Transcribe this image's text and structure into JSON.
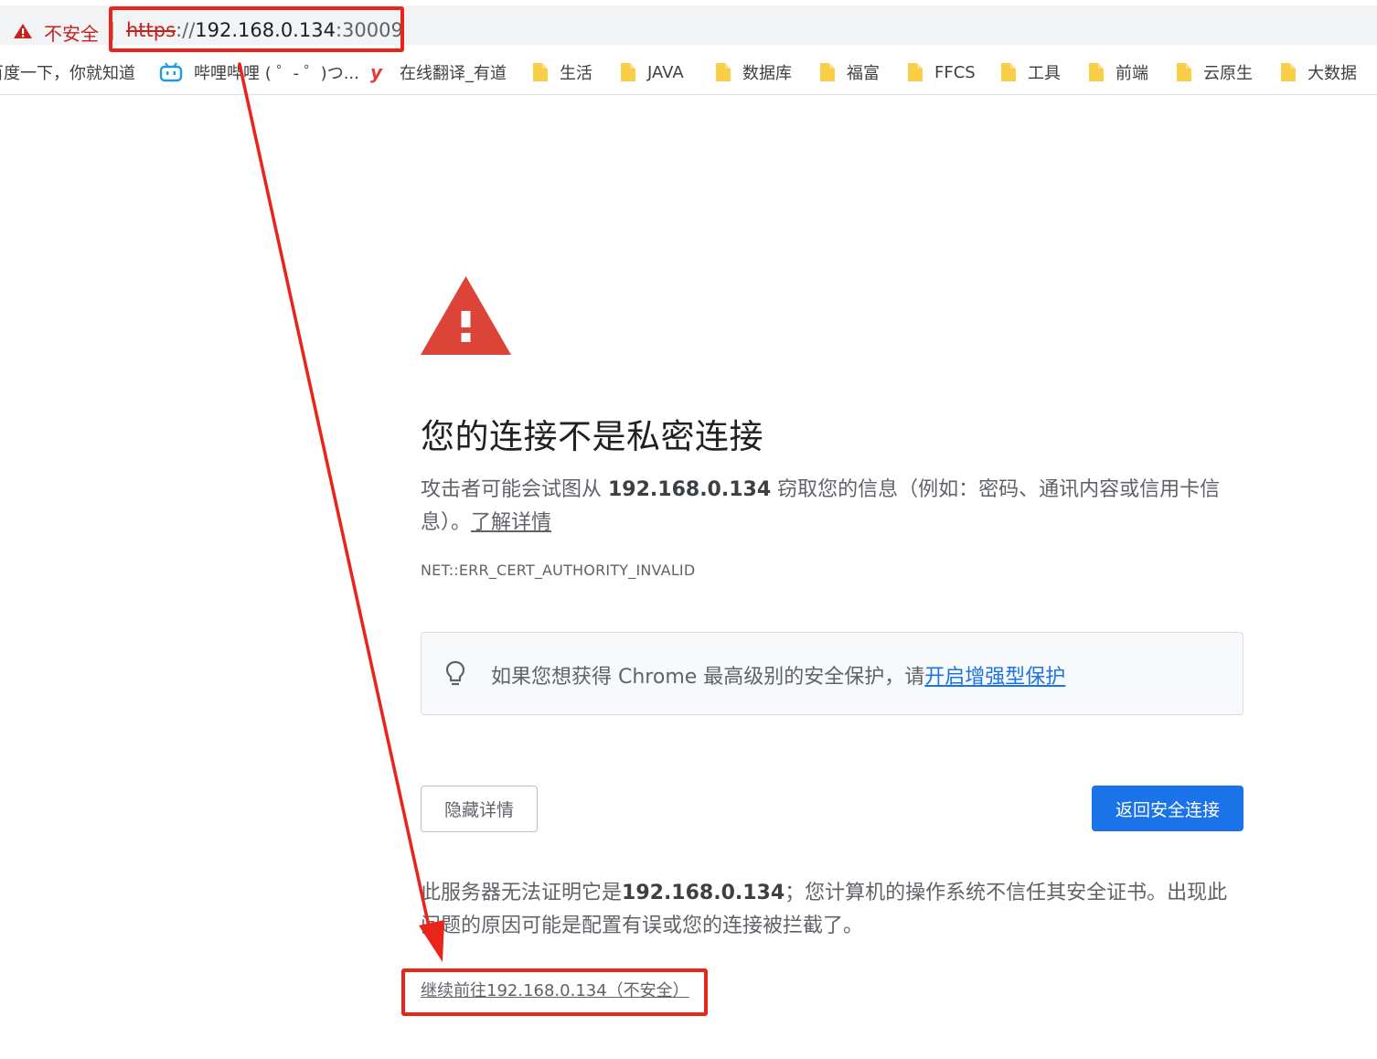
{
  "address_bar": {
    "security_label": "不安全",
    "url_scheme": "https",
    "url_separator": "://",
    "url_host": "192.168.0.134",
    "url_port": ":30009"
  },
  "bookmarks": [
    {
      "label": "百度一下，你就知道",
      "icon": "baidu-icon"
    },
    {
      "label": "哔哩哔哩 ( ゜- ゜)つ...",
      "icon": "bilibili-icon"
    },
    {
      "label": "在线翻译_有道",
      "icon": "youdao-icon"
    },
    {
      "label": "生活",
      "icon": "folder-icon"
    },
    {
      "label": "JAVA",
      "icon": "folder-icon"
    },
    {
      "label": "数据库",
      "icon": "folder-icon"
    },
    {
      "label": "福富",
      "icon": "folder-icon"
    },
    {
      "label": "FFCS",
      "icon": "folder-icon"
    },
    {
      "label": "工具",
      "icon": "folder-icon"
    },
    {
      "label": "前端",
      "icon": "folder-icon"
    },
    {
      "label": "云原生",
      "icon": "folder-icon"
    },
    {
      "label": "大数据",
      "icon": "folder-icon"
    }
  ],
  "interstitial": {
    "heading": "您的连接不是私密连接",
    "explanation_pre": "攻击者可能会试图从 ",
    "explanation_host": "192.168.0.134",
    "explanation_post": " 窃取您的信息（例如：密码、通讯内容或信用卡信息）。",
    "learn_more": "了解详情",
    "error_code": "NET::ERR_CERT_AUTHORITY_INVALID",
    "tip_text": "如果您想获得 Chrome 最高级别的安全保护，请",
    "tip_link": "开启增强型保护",
    "hide_details_button": "隐藏详情",
    "back_to_safety_button": "返回安全连接",
    "details_pre": "此服务器无法证明它是",
    "details_host": "192.168.0.134",
    "details_post": "；您计算机的操作系统不信任其安全证书。出现此问题的原因可能是配置有误或您的连接被拦截了。",
    "proceed_link": "继续前往192.168.0.134（不安全）"
  },
  "colors": {
    "danger_red": "#c5221f",
    "warning_triangle": "#db4437",
    "primary_blue": "#1a73e8",
    "annotation_red": "#e8241b",
    "folder_yellow": "#f9cf45"
  }
}
